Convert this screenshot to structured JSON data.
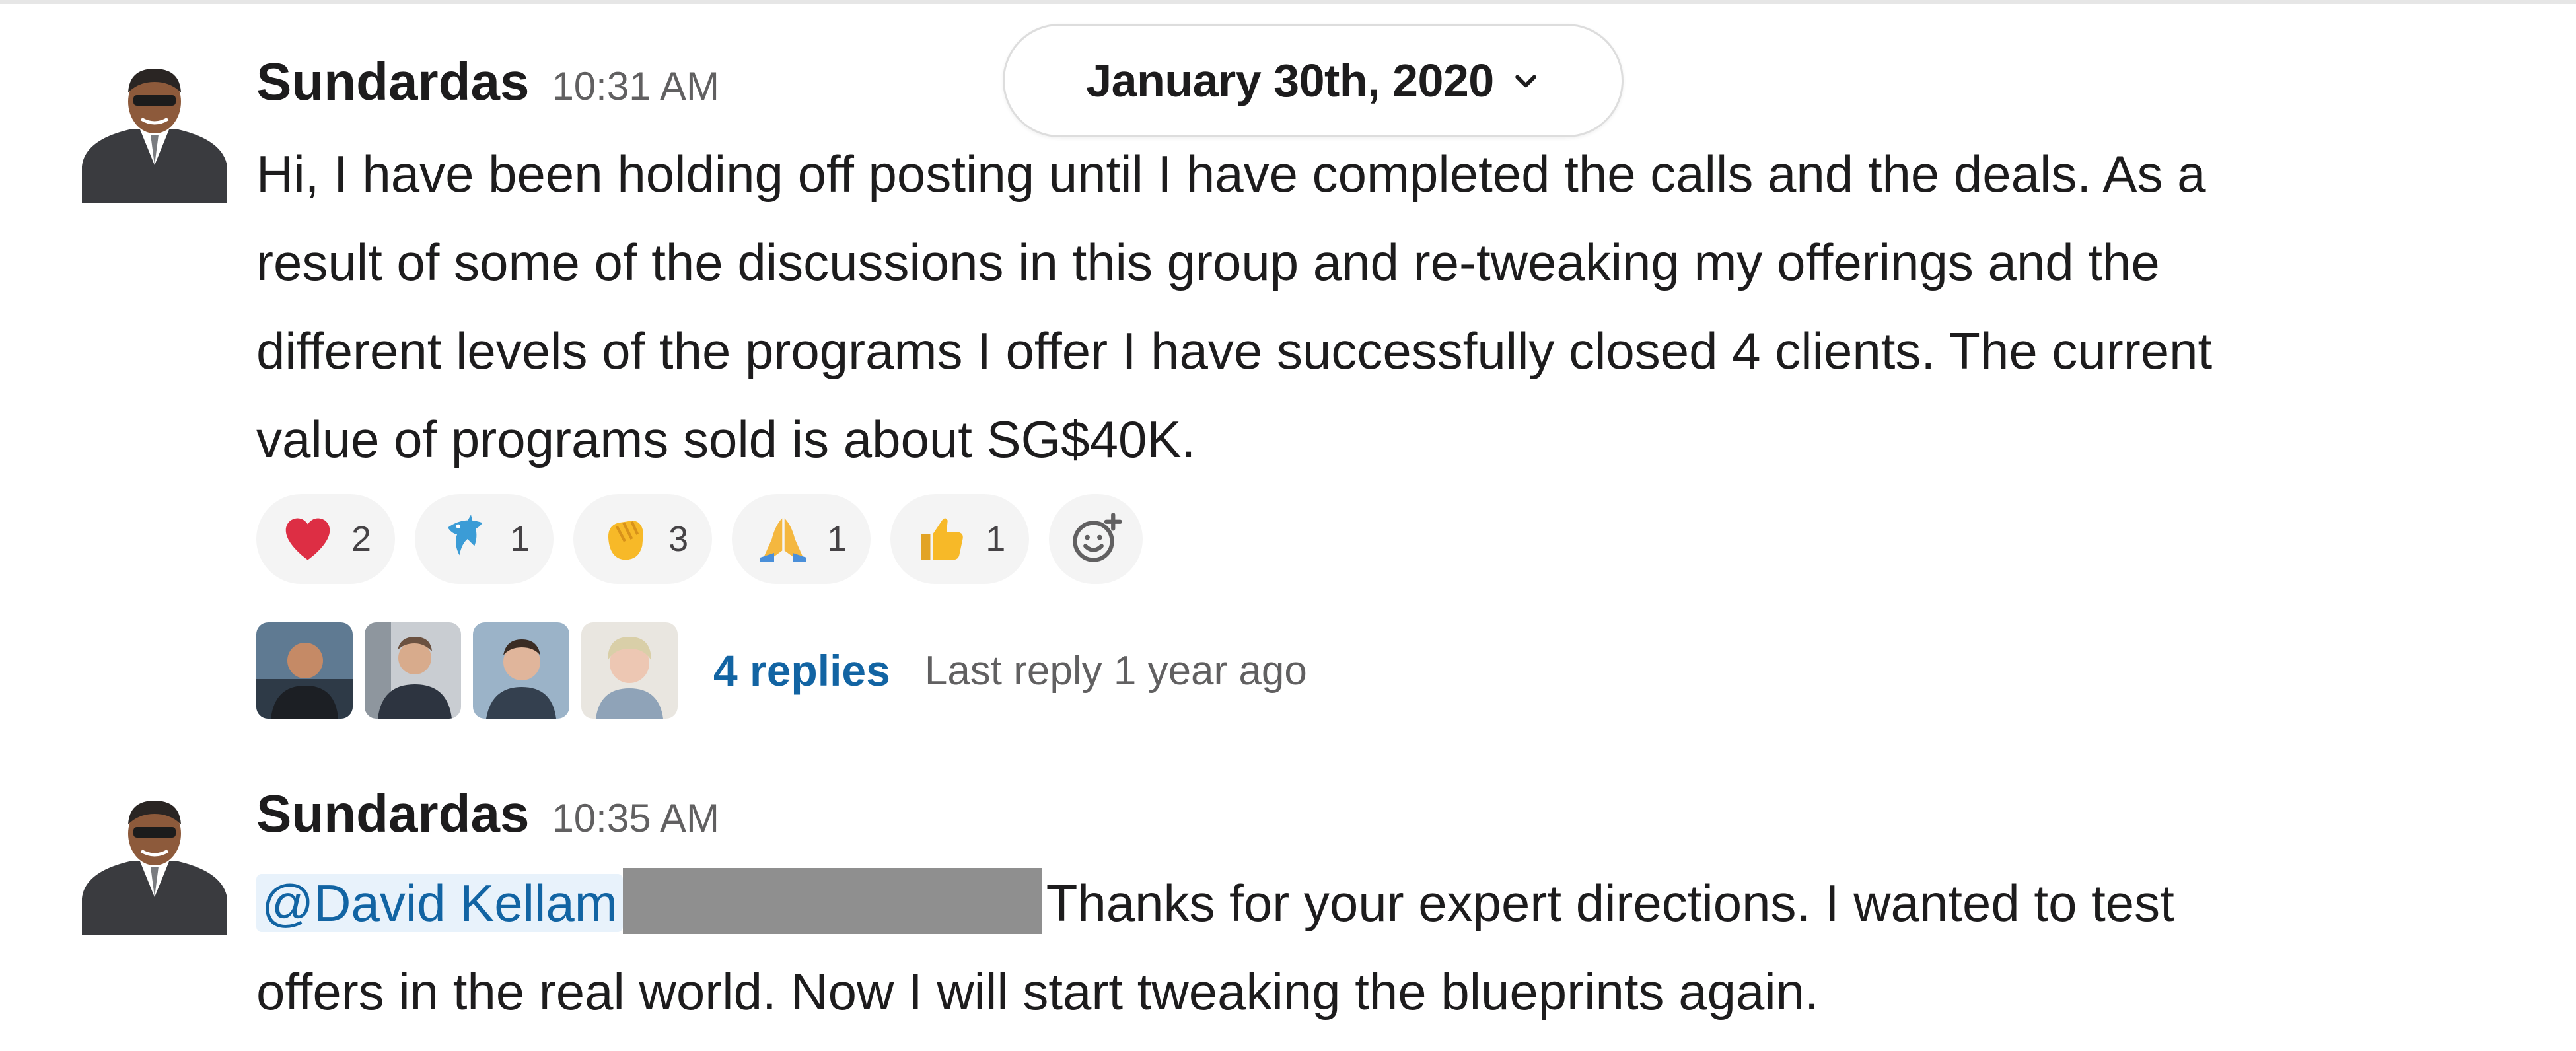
{
  "date_divider": {
    "label": "January 30th, 2020"
  },
  "messages": [
    {
      "sender": "Sundardas",
      "time": "10:31 AM",
      "lines": [
        "Hi, I have been holding off posting until I have completed the calls and the deals. As a",
        "result of some of the discussions in this group and re-tweaking my offerings and the",
        "different levels of the programs I offer I have successfully closed 4 clients. The current",
        "value of programs sold is about SG$40K."
      ],
      "reactions": [
        {
          "emoji": "heart-icon",
          "count": "2"
        },
        {
          "emoji": "dolphin-icon",
          "count": "1"
        },
        {
          "emoji": "clap-icon",
          "count": "3"
        },
        {
          "emoji": "pray-icon",
          "count": "1"
        },
        {
          "emoji": "thumbs-up-icon",
          "count": "1"
        }
      ],
      "thread": {
        "replies_label": "4 replies",
        "last_reply_label": "Last reply 1 year ago"
      }
    },
    {
      "sender": "Sundardas",
      "time": "10:35 AM",
      "mention": "@David Kellam",
      "line1_rest": "Thanks for your expert directions. I wanted to test",
      "line2": "offers in the real world. Now I will start tweaking the blueprints again."
    }
  ],
  "colors": {
    "link": "#1264a3",
    "mention_bg": "#e8f2fb",
    "reaction_bg": "#f4f4f4",
    "muted_text": "#616061"
  }
}
